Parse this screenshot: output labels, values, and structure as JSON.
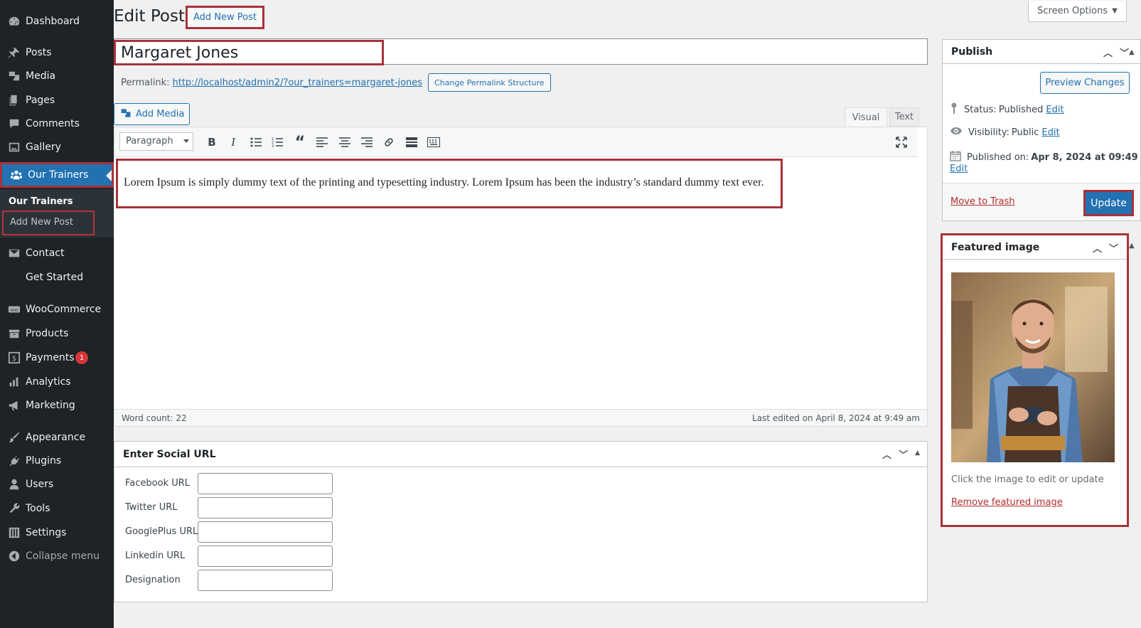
{
  "sidebar": {
    "items": [
      {
        "label": "Dashboard",
        "icon": "dashboard-icon"
      },
      {
        "label": "Posts",
        "icon": "pin-icon"
      },
      {
        "label": "Media",
        "icon": "media-icon"
      },
      {
        "label": "Pages",
        "icon": "pages-icon"
      },
      {
        "label": "Comments",
        "icon": "comments-icon"
      },
      {
        "label": "Gallery",
        "icon": "gallery-icon"
      },
      {
        "label": "Our Trainers",
        "icon": "groups-icon"
      },
      {
        "label": "Contact",
        "icon": "mail-icon"
      },
      {
        "label": "Get Started",
        "icon": ""
      },
      {
        "label": "WooCommerce",
        "icon": "woo-icon"
      },
      {
        "label": "Products",
        "icon": "archive-icon"
      },
      {
        "label": "Payments",
        "icon": "dollar-icon",
        "badge": "1"
      },
      {
        "label": "Analytics",
        "icon": "chart-icon"
      },
      {
        "label": "Marketing",
        "icon": "megaphone-icon"
      },
      {
        "label": "Appearance",
        "icon": "brush-icon"
      },
      {
        "label": "Plugins",
        "icon": "plug-icon"
      },
      {
        "label": "Users",
        "icon": "user-icon"
      },
      {
        "label": "Tools",
        "icon": "wrench-icon"
      },
      {
        "label": "Settings",
        "icon": "sliders-icon"
      },
      {
        "label": "Collapse menu",
        "icon": "collapse-icon"
      }
    ],
    "submenu": {
      "title": "Our Trainers",
      "item": "Add New Post"
    }
  },
  "header": {
    "title": "Edit Post",
    "add_new": "Add New Post",
    "screen_options": "Screen Options"
  },
  "post": {
    "title": "Margaret Jones",
    "permalink_label": "Permalink:",
    "permalink_url": "http://localhost/admin2/?our_trainers=margaret-jones",
    "permalink_button": "Change Permalink Structure",
    "add_media": "Add Media",
    "tab_visual": "Visual",
    "tab_text": "Text",
    "format": "Paragraph",
    "content": "Lorem Ipsum is simply dummy text of the printing and typesetting industry. Lorem Ipsum has been the industry’s standard dummy text ever.",
    "word_count": "Word count: 22",
    "last_edited": "Last edited on April 8, 2024 at 9:49 am"
  },
  "social": {
    "title": "Enter Social URL",
    "fields": [
      {
        "label": "Facebook URL",
        "value": ""
      },
      {
        "label": "Twitter URL",
        "value": ""
      },
      {
        "label": "GooglePlus URL",
        "value": ""
      },
      {
        "label": "Linkedin URL",
        "value": ""
      },
      {
        "label": "Designation",
        "value": ""
      }
    ]
  },
  "publish": {
    "title": "Publish",
    "preview": "Preview Changes",
    "status_label": "Status:",
    "status_value": "Published",
    "visibility_label": "Visibility:",
    "visibility_value": "Public",
    "published_label": "Published on:",
    "published_value": "Apr 8, 2024 at 09:49",
    "edit": "Edit",
    "trash": "Move to Trash",
    "update": "Update"
  },
  "featured": {
    "title": "Featured image",
    "caption": "Click the image to edit or update",
    "remove": "Remove featured image"
  },
  "colors": {
    "sidebar_bg": "#1d2327",
    "accent": "#2271b1",
    "highlight_border": "#a8323a",
    "badge": "#d63638"
  }
}
